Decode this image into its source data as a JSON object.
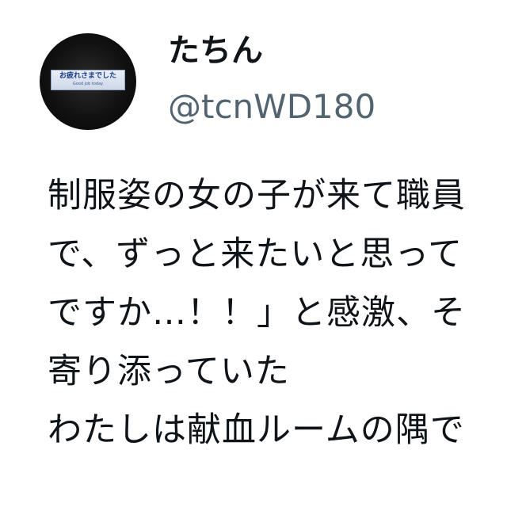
{
  "profile": {
    "display_name": "たちん",
    "handle": "@tcnWD180",
    "avatar_sign_text": "お疲れさまでした",
    "avatar_sign_subtext": "Good job today"
  },
  "tweet": {
    "lines": [
      "制服姿の女の子が来て職員",
      "で、ずっと来たいと思って",
      "ですか…！！」と感激、そ",
      "寄り添っていた",
      "わたしは献血ルームの隅で"
    ]
  },
  "colors": {
    "text_primary": "#0f1419",
    "text_secondary": "#536471",
    "background": "#ffffff"
  }
}
